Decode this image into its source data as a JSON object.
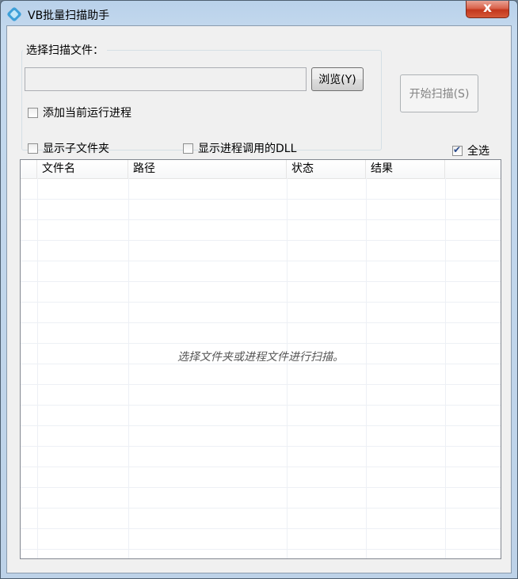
{
  "window": {
    "title": "VB批量扫描助手",
    "close_label": "x"
  },
  "scan_group": {
    "legend": "选择扫描文件：",
    "path_value": "",
    "browse_label": "浏览(Y)",
    "add_running_process_label": "添加当前运行进程",
    "add_running_process_checked": false
  },
  "start_button": {
    "label": "开始扫描(S)",
    "enabled": false
  },
  "options": {
    "show_subfolders_label": "显示子文件夹",
    "show_subfolders_checked": false,
    "show_process_dll_label": "显示进程调用的DLL",
    "show_process_dll_checked": false,
    "select_all_label": "全选",
    "select_all_checked": true
  },
  "table": {
    "columns": [
      "",
      "文件名",
      "路径",
      "状态",
      "结果",
      ""
    ],
    "rows": [],
    "empty_message": "选择文件夹或进程文件进行扫描。"
  },
  "icons": {
    "app": "app-scan-icon",
    "close": "close-icon",
    "check": "checkmark-icon"
  }
}
